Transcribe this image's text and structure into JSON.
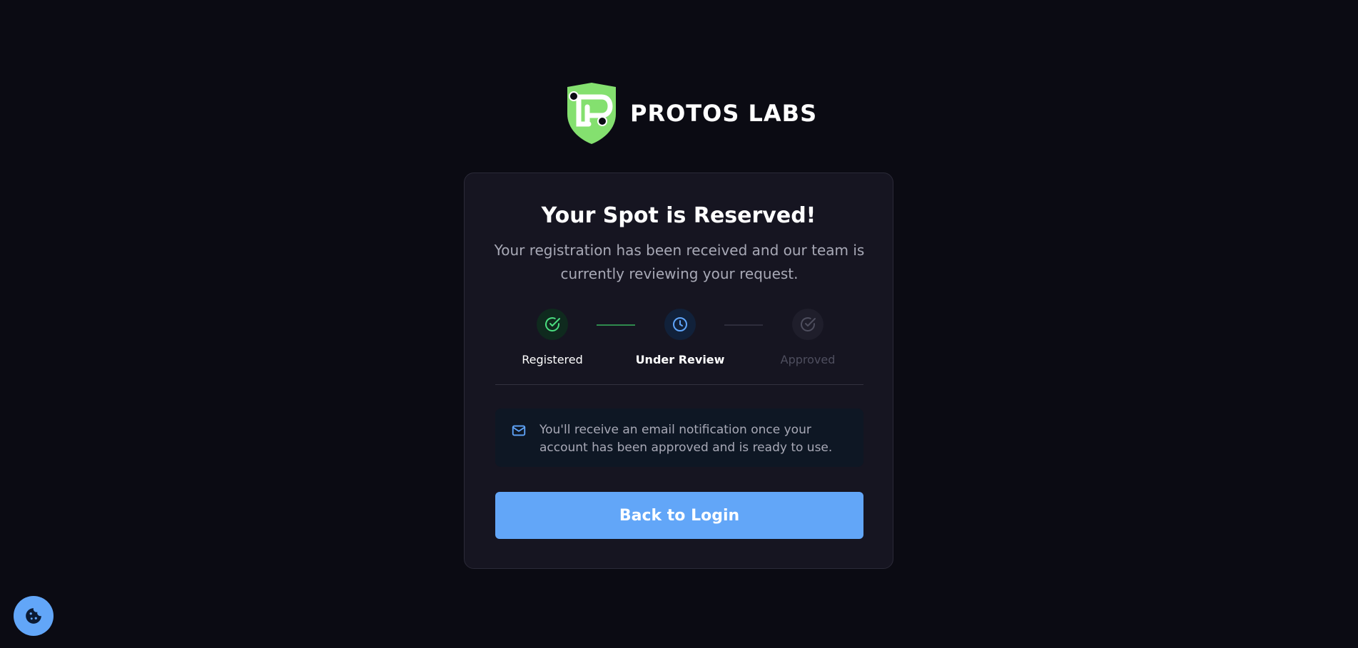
{
  "brand": {
    "name": "PROTOS LABS",
    "logo_icon": "shield-logo-icon",
    "logo_color": "#84e06f"
  },
  "card": {
    "title": "Your Spot is Reserved!",
    "subtitle": "Your registration has been received and our team is currently reviewing your request."
  },
  "steps": [
    {
      "label": "Registered",
      "status": "complete",
      "icon": "check-circle-icon",
      "color": "#4ade80"
    },
    {
      "label": "Under Review",
      "status": "current",
      "icon": "clock-icon",
      "color": "#60a5fa"
    },
    {
      "label": "Approved",
      "status": "pending",
      "icon": "check-circle-icon",
      "color": "#4e4e5e"
    }
  ],
  "notice": {
    "icon": "mail-icon",
    "text": "You'll receive an email notification once your account has been approved and is ready to use."
  },
  "actions": {
    "back_to_login": "Back to Login"
  },
  "cookie": {
    "icon": "cookie-icon"
  },
  "colors": {
    "background": "#0b0b13",
    "card": "#161521",
    "accent": "#62a6f8",
    "success": "#4ade80"
  }
}
